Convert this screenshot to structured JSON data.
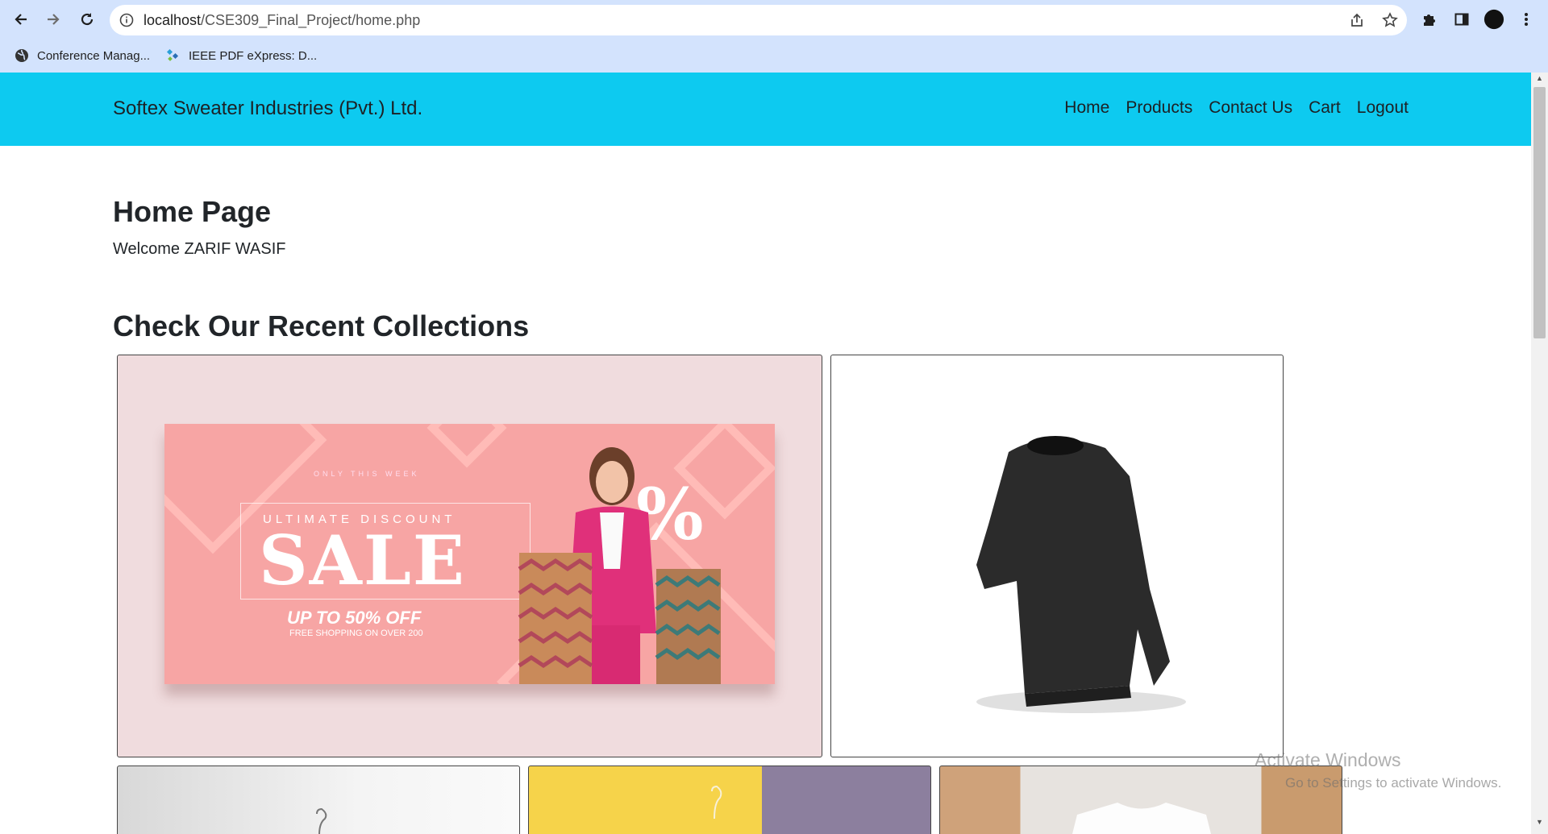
{
  "browser": {
    "url_host": "localhost",
    "url_path": "/CSE309_Final_Project/home.php",
    "bookmarks": [
      {
        "label": "Conference Manag...",
        "icon": "globe-icon"
      },
      {
        "label": "IEEE PDF eXpress: D...",
        "icon": "ieee-icon"
      }
    ]
  },
  "navbar": {
    "brand": "Softex Sweater Industries (Pvt.) Ltd.",
    "links": [
      "Home",
      "Products",
      "Contact Us",
      "Cart",
      "Logout"
    ],
    "bg_color": "#0dcaf0"
  },
  "main": {
    "title": "Home Page",
    "welcome": "Welcome ZARIF WASIF",
    "collections_title": "Check Our Recent Collections"
  },
  "sale_banner": {
    "only_this_week": "ONLY THIS WEEK",
    "ultimate": "ULTIMATE DISCOUNT",
    "sale": "SALE",
    "offer": "UP TO 50% OFF",
    "free": "FREE SHOPPING ON OVER 200",
    "percent": "%"
  },
  "os_watermark": {
    "line1": "Activate Windows",
    "line2": "Go to Settings to activate Windows."
  }
}
